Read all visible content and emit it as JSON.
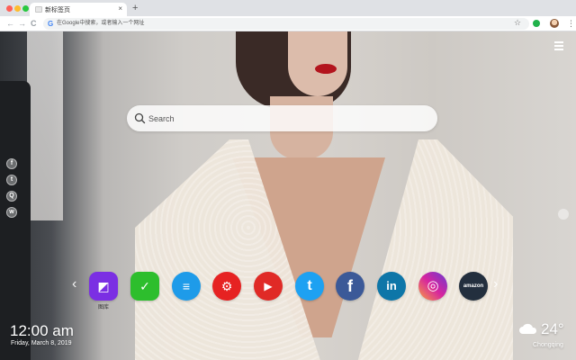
{
  "browser": {
    "traffic_lights": [
      "#ff5f57",
      "#febc2e",
      "#28c840"
    ],
    "tab_title": "新标签页",
    "tab_close": "×",
    "new_tab": "+",
    "nav": {
      "back": "←",
      "forward": "→",
      "reload": "C"
    },
    "omnibox_icon": "G",
    "omnibox_placeholder": "在Google中搜索，或者输入一个网址",
    "bookmark_star": "☆",
    "menu": "⋮"
  },
  "search": {
    "placeholder": "Search"
  },
  "social_links": [
    {
      "icon": "facebook-icon",
      "glyph": "f"
    },
    {
      "icon": "twitter-icon",
      "glyph": "t"
    },
    {
      "icon": "qq-icon",
      "glyph": "Q"
    },
    {
      "icon": "wechat-icon",
      "glyph": "w"
    }
  ],
  "dock": {
    "prev": "‹",
    "next": "›",
    "apps": [
      {
        "name": "gallery",
        "color": "#7b2fe3",
        "glyph": "◩",
        "label": "图库"
      },
      {
        "name": "tasks",
        "color": "#2dbe2d",
        "glyph": "✓"
      },
      {
        "name": "notes",
        "color": "#1e9be9",
        "glyph": "≡"
      },
      {
        "name": "games",
        "color": "#e62222",
        "glyph": "⚙"
      },
      {
        "name": "youtube",
        "color": "#e02a26",
        "glyph": "▶"
      },
      {
        "name": "twitter",
        "color": "#1da1f2",
        "glyph": "t"
      },
      {
        "name": "facebook",
        "color": "#3b5998",
        "glyph": "f"
      },
      {
        "name": "linkedin",
        "color": "#0e76a8",
        "glyph": "in"
      },
      {
        "name": "instagram",
        "color": "#d6249f",
        "glyph": "◎"
      },
      {
        "name": "amazon",
        "color": "#232f3e",
        "glyph": "amazon"
      }
    ]
  },
  "clock": {
    "time": "12:00 am",
    "date": "Friday, March 8, 2019"
  },
  "weather": {
    "icon": "cloud-icon",
    "temp": "24°",
    "city": "Chongqing"
  }
}
